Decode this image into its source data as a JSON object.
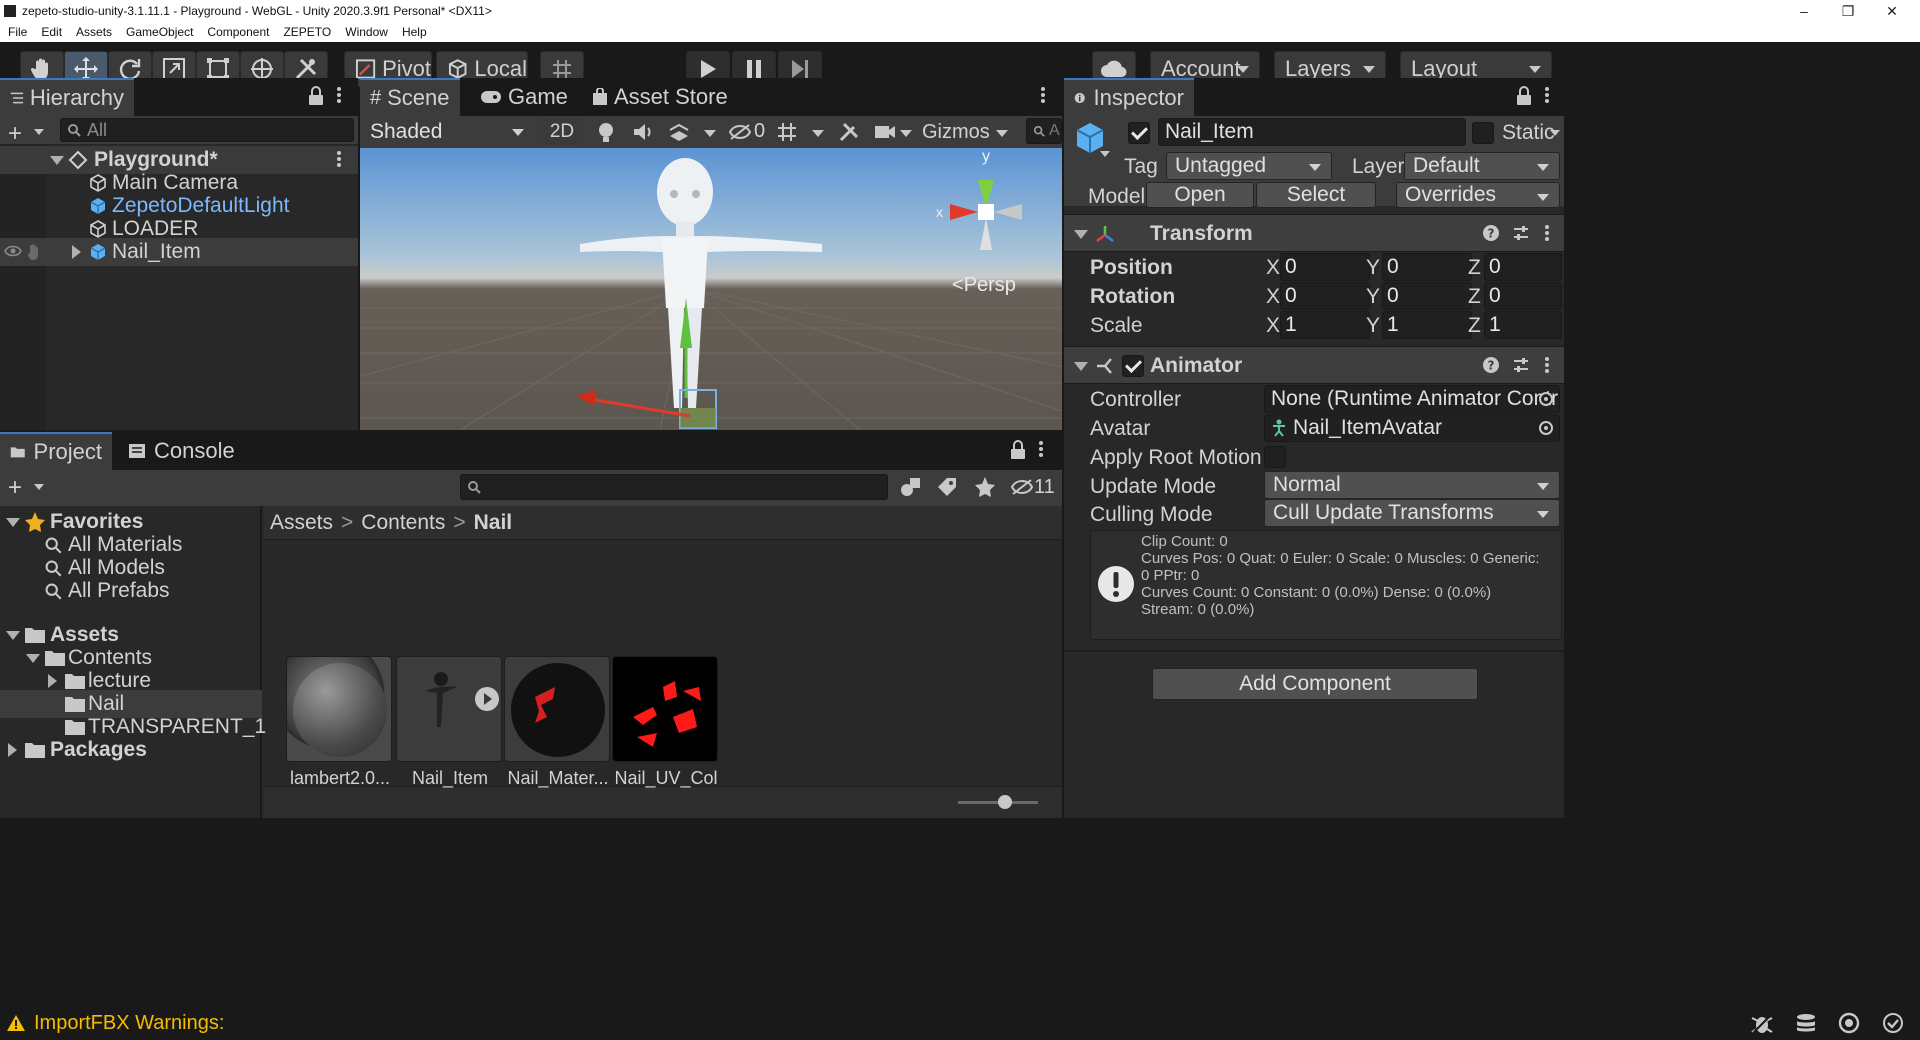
{
  "window": {
    "title": "zepeto-studio-unity-3.1.11.1 - Playground - WebGL - Unity 2020.3.9f1 Personal* <DX11>",
    "controls": [
      "–",
      "❐",
      "✕"
    ]
  },
  "menu": [
    "File",
    "Edit",
    "Assets",
    "GameObject",
    "Component",
    "ZEPETO",
    "Window",
    "Help"
  ],
  "toolbar": {
    "pivot_label": "Pivot",
    "local_label": "Local",
    "account_label": "Account",
    "layers_label": "Layers",
    "layout_label": "Layout"
  },
  "hierarchy": {
    "tab": "Hierarchy",
    "search_placeholder": "All",
    "scene": "Playground*",
    "items": [
      {
        "label": "Main Camera"
      },
      {
        "label": "ZepetoDefaultLight"
      },
      {
        "label": "LOADER"
      },
      {
        "label": "Nail_Item"
      }
    ]
  },
  "scene_view": {
    "tabs": [
      "Scene",
      "Game",
      "Asset Store"
    ],
    "shading": "Shaded",
    "mode_2d": "2D",
    "hidden_count": "0",
    "gizmos": "Gizmos",
    "gizmo_axis_y": "y",
    "gizmo_axis_x": "x",
    "persp": "Persp",
    "search_placeholder": "A"
  },
  "project": {
    "tabs": [
      "Project",
      "Console"
    ],
    "hidden_count": "11",
    "favorites": {
      "label": "Favorites",
      "items": [
        "All Materials",
        "All Models",
        "All Prefabs"
      ]
    },
    "assets_label": "Assets",
    "contents_label": "Contents",
    "folders": [
      "lecture",
      "Nail",
      "TRANSPARENT_1"
    ],
    "packages_label": "Packages",
    "breadcrumb": [
      "Assets",
      "Contents",
      "Nail"
    ],
    "files": [
      {
        "name": "lambert2.0..."
      },
      {
        "name": "Nail_Item"
      },
      {
        "name": "Nail_Mater..."
      },
      {
        "name": "Nail_UV_Col"
      }
    ]
  },
  "inspector": {
    "tab": "Inspector",
    "object_name": "Nail_Item",
    "static_label": "Static",
    "tag_label": "Tag",
    "tag_value": "Untagged",
    "layer_label": "Layer",
    "layer_value": "Default",
    "model_label": "Model",
    "open_label": "Open",
    "select_label": "Select",
    "overrides_label": "Overrides",
    "transform": {
      "title": "Transform",
      "rows": [
        {
          "label": "Position",
          "x": "0",
          "y": "0",
          "z": "0"
        },
        {
          "label": "Rotation",
          "x": "0",
          "y": "0",
          "z": "0"
        },
        {
          "label": "Scale",
          "x": "1",
          "y": "1",
          "z": "1"
        }
      ],
      "axis": {
        "x": "X",
        "y": "Y",
        "z": "Z"
      }
    },
    "animator": {
      "title": "Animator",
      "controller_label": "Controller",
      "controller_value": "None (Runtime Animator Controlle",
      "avatar_label": "Avatar",
      "avatar_value": "Nail_ItemAvatar",
      "root_motion_label": "Apply Root Motion",
      "update_mode_label": "Update Mode",
      "update_mode_value": "Normal",
      "culling_mode_label": "Culling Mode",
      "culling_mode_value": "Cull Update Transforms",
      "info_lines": [
        "Clip Count: 0",
        "Curves Pos: 0 Quat: 0 Euler: 0 Scale: 0 Muscles: 0 Generic:",
        "0 PPtr: 0",
        "Curves Count: 0 Constant: 0 (0.0%) Dense: 0 (0.0%)",
        "Stream: 0 (0.0%)"
      ]
    },
    "add_component": "Add Component"
  },
  "status": {
    "message": "ImportFBX Warnings:",
    "warning_color": "#f4bc02"
  },
  "colors": {
    "accent": "#3a79bb",
    "prefab_blue": "#7cb7ff",
    "panel": "#282828"
  }
}
